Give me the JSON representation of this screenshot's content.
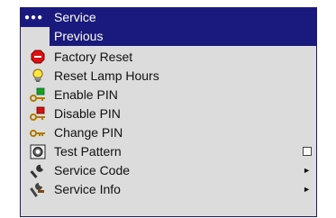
{
  "menu": {
    "header": {
      "dots": "●●●",
      "title": "Service"
    },
    "items": [
      {
        "label": "Previous",
        "icon": "none",
        "selected": true
      },
      {
        "label": "Factory Reset",
        "icon": "stop-sign-icon"
      },
      {
        "label": "Reset Lamp Hours",
        "icon": "lightbulb-icon"
      },
      {
        "label": "Enable PIN",
        "icon": "key-green-icon"
      },
      {
        "label": "Disable PIN",
        "icon": "key-red-icon"
      },
      {
        "label": "Change PIN",
        "icon": "key-icon"
      },
      {
        "label": "Test Pattern",
        "icon": "test-pattern-icon",
        "control": "checkbox",
        "checked": false
      },
      {
        "label": "Service Code",
        "icon": "wrench-icon",
        "control": "submenu-arrow",
        "arrow": "►"
      },
      {
        "label": "Service Info",
        "icon": "tools-icon",
        "control": "submenu-arrow",
        "arrow": "►"
      }
    ]
  },
  "colors": {
    "header_bg": "#1a1a7e",
    "menu_bg": "#dcdcdc",
    "selection_bg": "#1a1a7e"
  }
}
